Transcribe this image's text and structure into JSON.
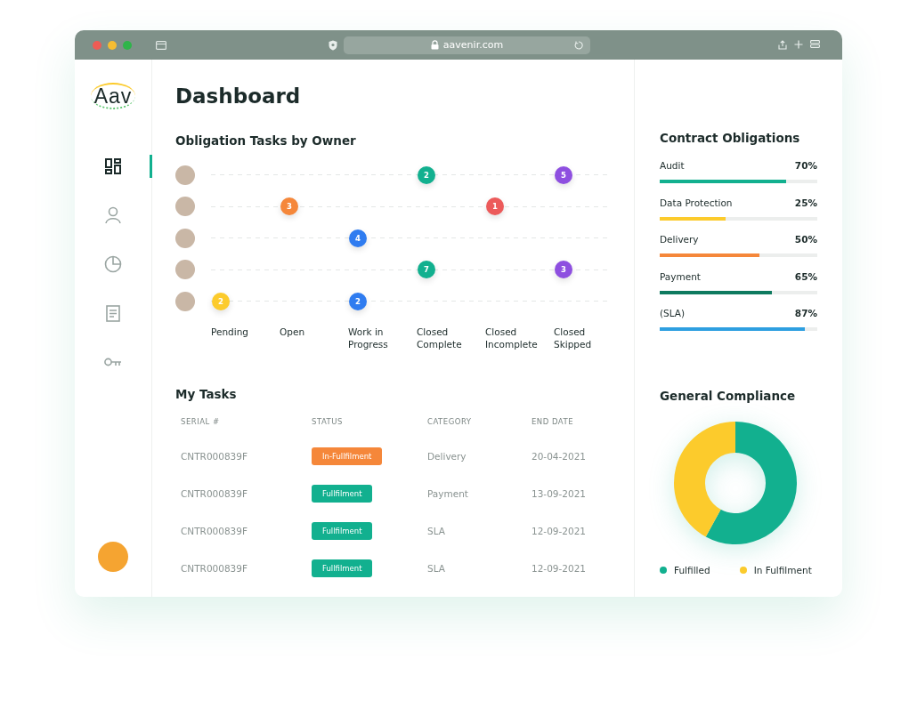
{
  "browser": {
    "url": "aavenir.com"
  },
  "sidebar": {
    "logo": "Aav",
    "items": [
      {
        "kind": "dashboard",
        "selected": true
      },
      {
        "kind": "user",
        "selected": false
      },
      {
        "kind": "chart",
        "selected": false
      },
      {
        "kind": "document",
        "selected": false
      },
      {
        "kind": "key",
        "selected": false
      }
    ]
  },
  "title": "Dashboard",
  "obligation_tasks": {
    "title": "Obligation Tasks by Owner",
    "statuses": [
      "Pending",
      "Open",
      "Work in Progress",
      "Closed Complete",
      "Closed Incomplete",
      "Closed Skipped"
    ],
    "owners": [
      {
        "cells": [
          null,
          null,
          null,
          {
            "count": "2",
            "color": "#12b08f"
          },
          null,
          {
            "count": "5",
            "color": "#8e4fe0"
          }
        ]
      },
      {
        "cells": [
          null,
          {
            "count": "3",
            "color": "#f5873a"
          },
          null,
          null,
          {
            "count": "1",
            "color": "#ec5a5a"
          },
          null
        ]
      },
      {
        "cells": [
          null,
          null,
          {
            "count": "4",
            "color": "#2f7cf0"
          },
          null,
          null,
          null
        ]
      },
      {
        "cells": [
          null,
          null,
          null,
          {
            "count": "7",
            "color": "#12b08f"
          },
          null,
          {
            "count": "3",
            "color": "#8e4fe0"
          }
        ]
      },
      {
        "cells": [
          {
            "count": "2",
            "color": "#fccb2c"
          },
          null,
          {
            "count": "2",
            "color": "#2f7cf0"
          },
          null,
          null,
          null
        ]
      }
    ]
  },
  "my_tasks": {
    "title": "My Tasks",
    "columns": [
      "SERIAL #",
      "STATUS",
      "CATEGORY",
      "END DATE"
    ],
    "rows": [
      {
        "serial": "CNTR000839F",
        "status": {
          "label": "In-Fullfilment",
          "color": "#f5873a"
        },
        "category": "Delivery",
        "end_date": "20-04-2021"
      },
      {
        "serial": "CNTR000839F",
        "status": {
          "label": "Fullfilment",
          "color": "#12b08f"
        },
        "category": "Payment",
        "end_date": "13-09-2021"
      },
      {
        "serial": "CNTR000839F",
        "status": {
          "label": "Fullfilment",
          "color": "#12b08f"
        },
        "category": "SLA",
        "end_date": "12-09-2021"
      },
      {
        "serial": "CNTR000839F",
        "status": {
          "label": "Fullfilment",
          "color": "#12b08f"
        },
        "category": "SLA",
        "end_date": "12-09-2021"
      }
    ]
  },
  "contract_obligations": {
    "title": "Contract Obligations",
    "items": [
      {
        "label": "Audit",
        "reading": "70%",
        "level": 0.8,
        "color": "#12b08f"
      },
      {
        "label": "Data Protection",
        "reading": "25%",
        "level": 0.42,
        "color": "#fccb2c"
      },
      {
        "label": "Delivery",
        "reading": "50%",
        "level": 0.63,
        "color": "#f5873a"
      },
      {
        "label": "Payment",
        "reading": "65%",
        "level": 0.71,
        "color": "#0e7a5f"
      },
      {
        "label": "(SLA)",
        "reading": "87%",
        "level": 0.92,
        "color": "#2e9fe0"
      }
    ]
  },
  "general_compliance": {
    "title": "General Compliance",
    "legend": [
      {
        "label": "Fulfilled",
        "color": "#12b08f"
      },
      {
        "label": "In Fulfilment",
        "color": "#fccb2c"
      }
    ]
  }
}
